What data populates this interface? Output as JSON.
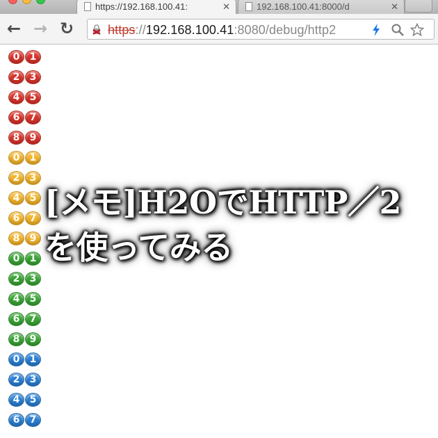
{
  "browser": {
    "tabs": [
      {
        "title": "https://192.168.100.41:",
        "active": true
      },
      {
        "title": "192.168.100.41:8000/d",
        "active": false
      }
    ],
    "address_bar": {
      "scheme": "https",
      "separator": "://",
      "host": "192.168.100.41",
      "port": ":8080",
      "path": "/debug/http2"
    },
    "icons": {
      "back": "back-arrow-icon",
      "forward": "forward-arrow-icon",
      "reload": "reload-icon",
      "insecure_lock": "broken-lock-icon",
      "bolt": "lightning-bolt-icon",
      "search": "search-icon",
      "bookmark": "star-icon"
    }
  },
  "page": {
    "badge_rows": [
      {
        "digits": [
          "0",
          "1"
        ],
        "color": "#d9342b"
      },
      {
        "digits": [
          "2",
          "3"
        ],
        "color": "#d9342b"
      },
      {
        "digits": [
          "4",
          "5"
        ],
        "color": "#d9342b"
      },
      {
        "digits": [
          "6",
          "7"
        ],
        "color": "#d9342b"
      },
      {
        "digits": [
          "8",
          "9"
        ],
        "color": "#d9342b"
      },
      {
        "digits": [
          "0",
          "1"
        ],
        "color": "#f4b52c"
      },
      {
        "digits": [
          "2",
          "3"
        ],
        "color": "#f4b52c"
      },
      {
        "digits": [
          "4",
          "5"
        ],
        "color": "#f4b52c"
      },
      {
        "digits": [
          "6",
          "7"
        ],
        "color": "#f4b52c"
      },
      {
        "digits": [
          "8",
          "9"
        ],
        "color": "#f4b52c"
      },
      {
        "digits": [
          "0",
          "1"
        ],
        "color": "#3aa535"
      },
      {
        "digits": [
          "2",
          "3"
        ],
        "color": "#3aa535"
      },
      {
        "digits": [
          "4",
          "5"
        ],
        "color": "#3aa535"
      },
      {
        "digits": [
          "6",
          "7"
        ],
        "color": "#3aa535"
      },
      {
        "digits": [
          "8",
          "9"
        ],
        "color": "#3aa535"
      },
      {
        "digits": [
          "0",
          "1"
        ],
        "color": "#2a7fd4"
      },
      {
        "digits": [
          "2",
          "3"
        ],
        "color": "#2a7fd4"
      },
      {
        "digits": [
          "4",
          "5"
        ],
        "color": "#2a7fd4"
      },
      {
        "digits": [
          "6",
          "7"
        ],
        "color": "#2a7fd4"
      }
    ]
  },
  "overlay": {
    "line1": "[メモ]H2OでHTTP／2",
    "line2": "を使ってみる"
  }
}
